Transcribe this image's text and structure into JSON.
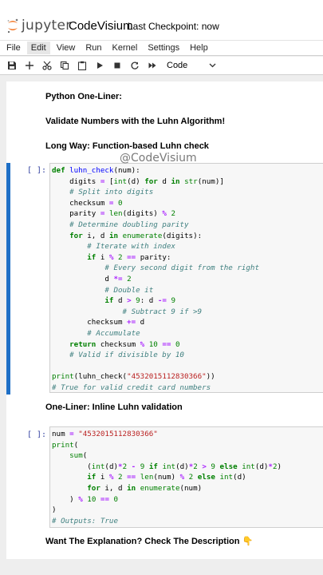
{
  "header": {
    "logo_text": "jupyter",
    "notebook_name": "CodeVisium",
    "checkpoint": "Last Checkpoint: now"
  },
  "menu": [
    "File",
    "Edit",
    "View",
    "Run",
    "Kernel",
    "Settings",
    "Help"
  ],
  "toolbar": {
    "cell_type": "Code",
    "icons": [
      "save-icon",
      "add-cell-icon",
      "cut-icon",
      "copy-icon",
      "paste-icon",
      "run-icon",
      "stop-icon",
      "restart-icon",
      "fast-forward-icon"
    ]
  },
  "cells": {
    "md1": "Python One-Liner:",
    "md2": "Validate Numbers with the Luhn Algorithm!",
    "md3": "Long Way: Function-based Luhn check",
    "prompt1": "[ ]:",
    "md4": "One-Liner: Inline Luhn validation",
    "prompt2": "[ ]:",
    "md5": "Want The Explanation? Check The Description 👇"
  },
  "code1_tokens": [
    [
      [
        "kw",
        "def "
      ],
      [
        "fn",
        "luhn_check"
      ],
      [
        "",
        "(num):"
      ]
    ],
    [
      [
        "",
        "    digits "
      ],
      [
        "op",
        "="
      ],
      [
        "",
        " ["
      ],
      [
        "bi",
        "int"
      ],
      [
        "",
        "(d) "
      ],
      [
        "kw",
        "for"
      ],
      [
        "",
        " d "
      ],
      [
        "kw",
        "in"
      ],
      [
        "",
        " "
      ],
      [
        "bi",
        "str"
      ],
      [
        "",
        "(num)]"
      ]
    ],
    [
      [
        "cm",
        "    # Split into digits"
      ]
    ],
    [
      [
        "",
        "    checksum "
      ],
      [
        "op",
        "="
      ],
      [
        "",
        " "
      ],
      [
        "num",
        "0"
      ]
    ],
    [
      [
        "",
        "    parity "
      ],
      [
        "op",
        "="
      ],
      [
        "",
        " "
      ],
      [
        "bi",
        "len"
      ],
      [
        "",
        "(digits) "
      ],
      [
        "op",
        "%"
      ],
      [
        "",
        " "
      ],
      [
        "num",
        "2"
      ]
    ],
    [
      [
        "cm",
        "    # Determine doubling parity"
      ]
    ],
    [
      [
        "kw",
        "    for"
      ],
      [
        "",
        " i, d "
      ],
      [
        "kw",
        "in"
      ],
      [
        "",
        " "
      ],
      [
        "bi",
        "enumerate"
      ],
      [
        "",
        "(digits):"
      ]
    ],
    [
      [
        "cm",
        "        # Iterate with index"
      ]
    ],
    [
      [
        "kw",
        "        if"
      ],
      [
        "",
        " i "
      ],
      [
        "op",
        "%"
      ],
      [
        "",
        " "
      ],
      [
        "num",
        "2"
      ],
      [
        "",
        " "
      ],
      [
        "op",
        "=="
      ],
      [
        "",
        " parity:"
      ]
    ],
    [
      [
        "cm",
        "            # Every second digit from the right"
      ]
    ],
    [
      [
        "",
        "            d "
      ],
      [
        "op",
        "*="
      ],
      [
        "",
        " "
      ],
      [
        "num",
        "2"
      ]
    ],
    [
      [
        "cm",
        "            # Double it"
      ]
    ],
    [
      [
        "kw",
        "            if"
      ],
      [
        "",
        " d "
      ],
      [
        "op",
        ">"
      ],
      [
        "",
        " "
      ],
      [
        "num",
        "9"
      ],
      [
        "",
        ": d "
      ],
      [
        "op",
        "-="
      ],
      [
        "",
        " "
      ],
      [
        "num",
        "9"
      ]
    ],
    [
      [
        "cm",
        "                # Subtract 9 if >9"
      ]
    ],
    [
      [
        "",
        "        checksum "
      ],
      [
        "op",
        "+="
      ],
      [
        "",
        " d"
      ]
    ],
    [
      [
        "cm",
        "        # Accumulate"
      ]
    ],
    [
      [
        "kw",
        "    return"
      ],
      [
        "",
        " checksum "
      ],
      [
        "op",
        "%"
      ],
      [
        "",
        " "
      ],
      [
        "num",
        "10"
      ],
      [
        "",
        " "
      ],
      [
        "op",
        "=="
      ],
      [
        "",
        " "
      ],
      [
        "num",
        "0"
      ]
    ],
    [
      [
        "cm",
        "    # Valid if divisible by 10"
      ]
    ],
    [
      [
        "",
        ""
      ]
    ],
    [
      [
        "bi",
        "print"
      ],
      [
        "",
        "(luhn_check("
      ],
      [
        "str",
        "\"4532015112830366\""
      ],
      [
        "",
        "))"
      ]
    ],
    [
      [
        "cm",
        "# True for valid credit card numbers"
      ]
    ]
  ],
  "code2_tokens": [
    [
      [
        "",
        "num "
      ],
      [
        "op",
        "="
      ],
      [
        "",
        " "
      ],
      [
        "str",
        "\"4532015112830366\""
      ]
    ],
    [
      [
        "bi",
        "print"
      ],
      [
        "",
        "("
      ]
    ],
    [
      [
        "bi",
        "    sum"
      ],
      [
        "",
        "("
      ]
    ],
    [
      [
        "",
        "        ("
      ],
      [
        "bi",
        "int"
      ],
      [
        "",
        "(d)"
      ],
      [
        "op",
        "*"
      ],
      [
        "num",
        "2"
      ],
      [
        "",
        " "
      ],
      [
        "op",
        "-"
      ],
      [
        "",
        " "
      ],
      [
        "num",
        "9"
      ],
      [
        "",
        " "
      ],
      [
        "kw",
        "if"
      ],
      [
        "",
        " "
      ],
      [
        "bi",
        "int"
      ],
      [
        "",
        "(d)"
      ],
      [
        "op",
        "*"
      ],
      [
        "num",
        "2"
      ],
      [
        "",
        " "
      ],
      [
        "op",
        ">"
      ],
      [
        "",
        " "
      ],
      [
        "num",
        "9"
      ],
      [
        "",
        " "
      ],
      [
        "kw",
        "else"
      ],
      [
        "",
        " "
      ],
      [
        "bi",
        "int"
      ],
      [
        "",
        "(d)"
      ],
      [
        "op",
        "*"
      ],
      [
        "num",
        "2"
      ],
      [
        "",
        ")"
      ]
    ],
    [
      [
        "kw",
        "        if"
      ],
      [
        "",
        " i "
      ],
      [
        "op",
        "%"
      ],
      [
        "",
        " "
      ],
      [
        "num",
        "2"
      ],
      [
        "",
        " "
      ],
      [
        "op",
        "=="
      ],
      [
        "",
        " "
      ],
      [
        "bi",
        "len"
      ],
      [
        "",
        "(num) "
      ],
      [
        "op",
        "%"
      ],
      [
        "",
        " "
      ],
      [
        "num",
        "2"
      ],
      [
        "",
        " "
      ],
      [
        "kw",
        "else"
      ],
      [
        "",
        " "
      ],
      [
        "bi",
        "int"
      ],
      [
        "",
        "(d)"
      ]
    ],
    [
      [
        "kw",
        "        for"
      ],
      [
        "",
        " i, d "
      ],
      [
        "kw",
        "in"
      ],
      [
        "",
        " "
      ],
      [
        "bi",
        "enumerate"
      ],
      [
        "",
        "(num)"
      ]
    ],
    [
      [
        "",
        "    ) "
      ],
      [
        "op",
        "%"
      ],
      [
        "",
        " "
      ],
      [
        "num",
        "10"
      ],
      [
        "",
        " "
      ],
      [
        "op",
        "=="
      ],
      [
        "",
        " "
      ],
      [
        "num",
        "0"
      ]
    ],
    [
      [
        "",
        ")"
      ]
    ],
    [
      [
        "cm",
        "# Outputs: True"
      ]
    ]
  ],
  "watermark": "@CodeVisium",
  "colors": {
    "accent": "#1e6fc6",
    "keyword": "#008000",
    "string": "#ba2121",
    "operator": "#aa22ff",
    "comment": "#408080",
    "prompt": "#303f9f",
    "logo_orange": "#f37726"
  }
}
